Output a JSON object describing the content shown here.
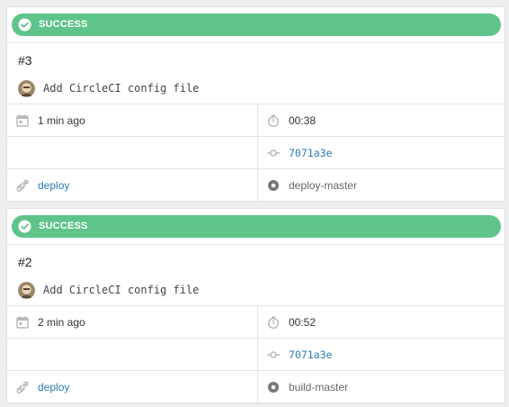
{
  "builds": [
    {
      "status": "SUCCESS",
      "number": "#3",
      "commit_message": "Add CircleCI config file",
      "time_ago": "1 min ago",
      "duration": "00:38",
      "commit_hash": "7071a3e",
      "workflow": "deploy",
      "job": "deploy-master"
    },
    {
      "status": "SUCCESS",
      "number": "#2",
      "commit_message": "Add CircleCI config file",
      "time_ago": "2 min ago",
      "duration": "00:52",
      "commit_hash": "7071a3e",
      "workflow": "deploy",
      "job": "build-master"
    }
  ],
  "colors": {
    "success": "#5ec48a",
    "link": "#2b7bb2",
    "icon": "#b8b8b8"
  },
  "icons": [
    "check-circle-icon",
    "calendar-icon",
    "stopwatch-icon",
    "commit-icon",
    "workflow-icon",
    "job-icon"
  ]
}
